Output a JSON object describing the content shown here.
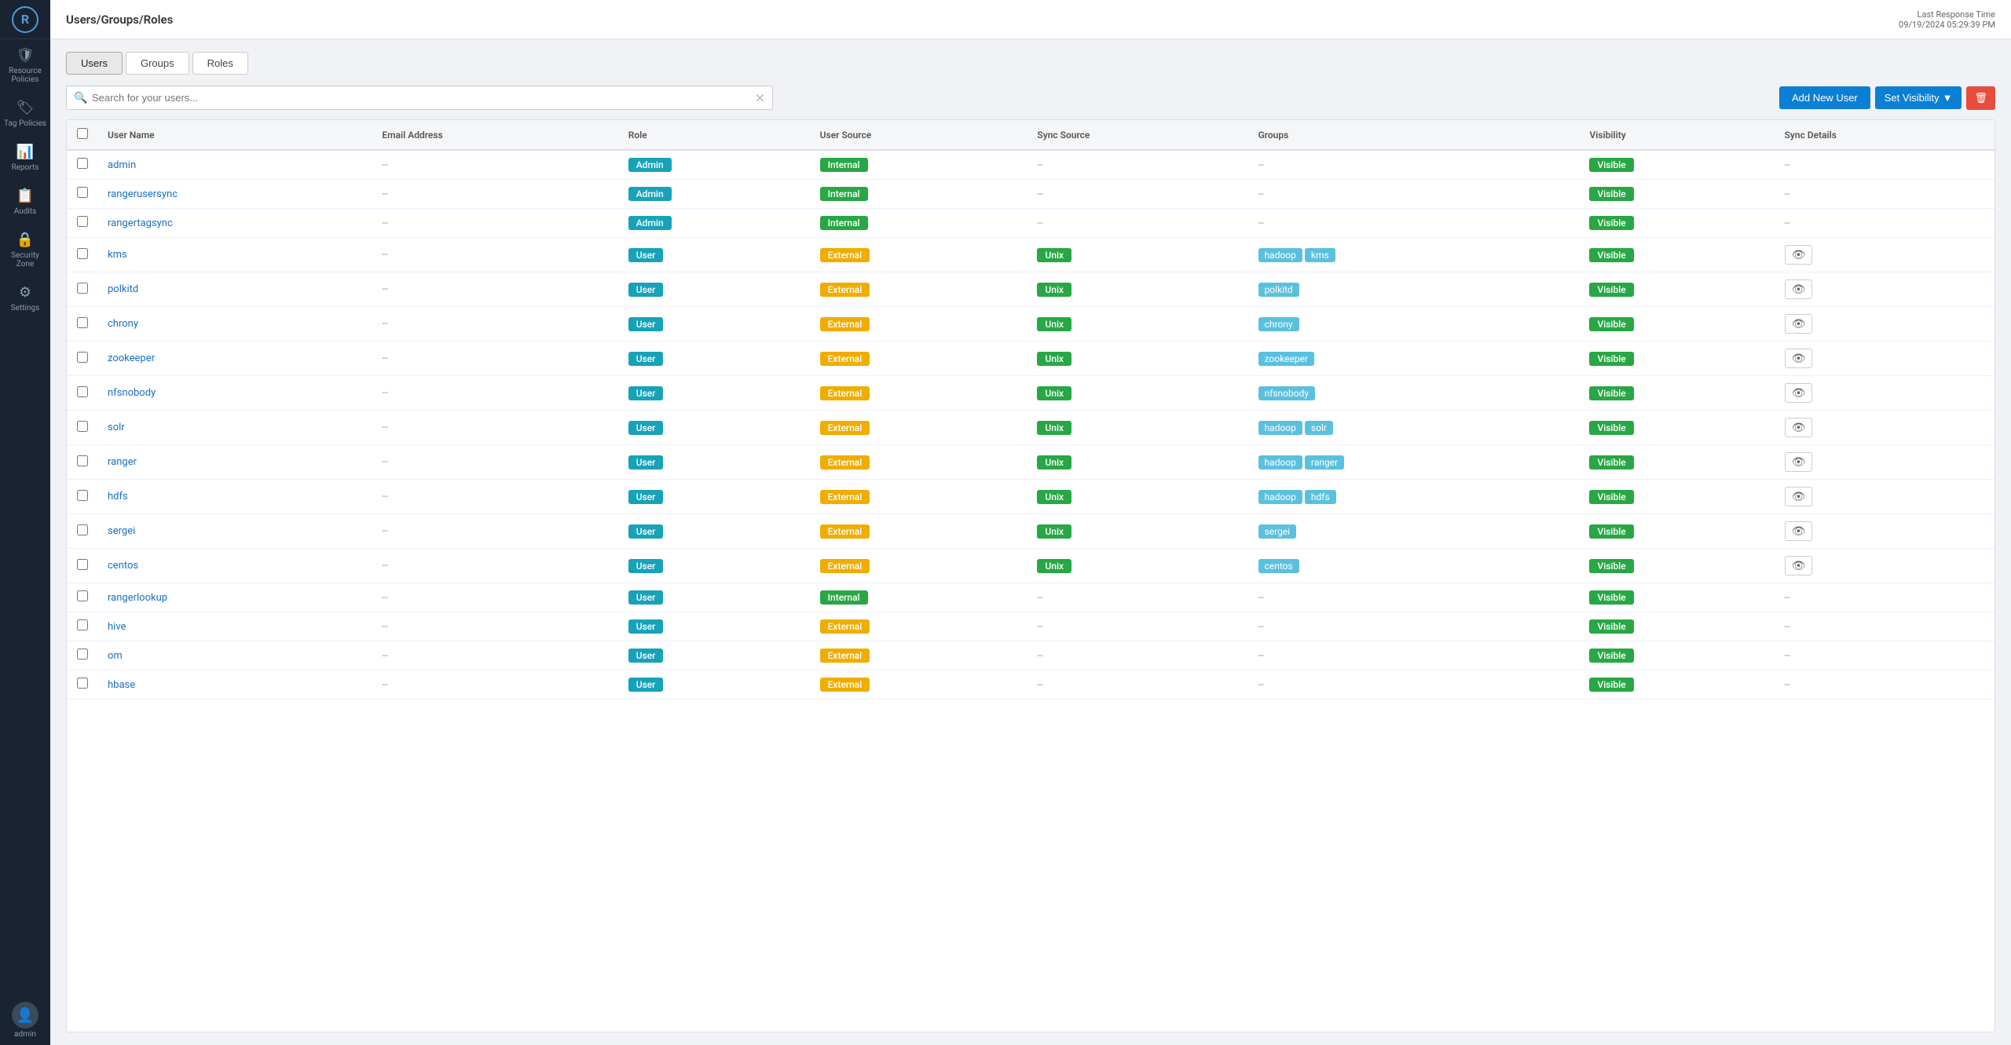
{
  "sidebar": {
    "logo": "R",
    "items": [
      {
        "id": "resource-policies",
        "label": "Resource Policies",
        "icon": "🛡"
      },
      {
        "id": "tag-policies",
        "label": "Tag Policies",
        "icon": "🏷"
      },
      {
        "id": "reports",
        "label": "Reports",
        "icon": "📊"
      },
      {
        "id": "audits",
        "label": "Audits",
        "icon": "📋"
      },
      {
        "id": "security-zone",
        "label": "Security Zone",
        "icon": "🔒"
      },
      {
        "id": "settings",
        "label": "Settings",
        "icon": "⚙"
      }
    ],
    "bottom": {
      "avatar_icon": "👤",
      "user_label": "admin"
    }
  },
  "topbar": {
    "title": "Users/Groups/Roles",
    "meta_label": "Last Response Time",
    "meta_value": "09/19/2024 05:29:39 PM"
  },
  "tabs": [
    {
      "id": "users",
      "label": "Users",
      "active": true
    },
    {
      "id": "groups",
      "label": "Groups",
      "active": false
    },
    {
      "id": "roles",
      "label": "Roles",
      "active": false
    }
  ],
  "toolbar": {
    "search_placeholder": "Search for your users...",
    "add_button": "Add New User",
    "visibility_button": "Set Visibility",
    "delete_icon": "🗑"
  },
  "table": {
    "columns": [
      "",
      "User Name",
      "Email Address",
      "Role",
      "User Source",
      "Sync Source",
      "Groups",
      "Visibility",
      "Sync Details"
    ],
    "rows": [
      {
        "name": "admin",
        "email": "--",
        "role": "Admin",
        "role_type": "admin",
        "user_source": "Internal",
        "user_source_type": "internal",
        "sync_source": "--",
        "groups": [],
        "visibility": "Visible",
        "sync_details": "--",
        "show_eye": false
      },
      {
        "name": "rangerusersync",
        "email": "--",
        "role": "Admin",
        "role_type": "admin",
        "user_source": "Internal",
        "user_source_type": "internal",
        "sync_source": "--",
        "groups": [],
        "visibility": "Visible",
        "sync_details": "--",
        "show_eye": false
      },
      {
        "name": "rangertagsync",
        "email": "--",
        "role": "Admin",
        "role_type": "admin",
        "user_source": "Internal",
        "user_source_type": "internal",
        "sync_source": "--",
        "groups": [],
        "visibility": "Visible",
        "sync_details": "--",
        "show_eye": false
      },
      {
        "name": "kms",
        "email": "--",
        "role": "User",
        "role_type": "user",
        "user_source": "External",
        "user_source_type": "external",
        "sync_source": "Unix",
        "groups": [
          "hadoop",
          "kms"
        ],
        "visibility": "Visible",
        "sync_details": "",
        "show_eye": true
      },
      {
        "name": "polkitd",
        "email": "--",
        "role": "User",
        "role_type": "user",
        "user_source": "External",
        "user_source_type": "external",
        "sync_source": "Unix",
        "groups": [
          "polkitd"
        ],
        "visibility": "Visible",
        "sync_details": "",
        "show_eye": true
      },
      {
        "name": "chrony",
        "email": "--",
        "role": "User",
        "role_type": "user",
        "user_source": "External",
        "user_source_type": "external",
        "sync_source": "Unix",
        "groups": [
          "chrony"
        ],
        "visibility": "Visible",
        "sync_details": "",
        "show_eye": true
      },
      {
        "name": "zookeeper",
        "email": "--",
        "role": "User",
        "role_type": "user",
        "user_source": "External",
        "user_source_type": "external",
        "sync_source": "Unix",
        "groups": [
          "zookeeper"
        ],
        "visibility": "Visible",
        "sync_details": "",
        "show_eye": true
      },
      {
        "name": "nfsnobody",
        "email": "--",
        "role": "User",
        "role_type": "user",
        "user_source": "External",
        "user_source_type": "external",
        "sync_source": "Unix",
        "groups": [
          "nfsnobody"
        ],
        "visibility": "Visible",
        "sync_details": "",
        "show_eye": true
      },
      {
        "name": "solr",
        "email": "--",
        "role": "User",
        "role_type": "user",
        "user_source": "External",
        "user_source_type": "external",
        "sync_source": "Unix",
        "groups": [
          "hadoop",
          "solr"
        ],
        "visibility": "Visible",
        "sync_details": "",
        "show_eye": true
      },
      {
        "name": "ranger",
        "email": "--",
        "role": "User",
        "role_type": "user",
        "user_source": "External",
        "user_source_type": "external",
        "sync_source": "Unix",
        "groups": [
          "hadoop",
          "ranger"
        ],
        "visibility": "Visible",
        "sync_details": "",
        "show_eye": true
      },
      {
        "name": "hdfs",
        "email": "--",
        "role": "User",
        "role_type": "user",
        "user_source": "External",
        "user_source_type": "external",
        "sync_source": "Unix",
        "groups": [
          "hadoop",
          "hdfs"
        ],
        "visibility": "Visible",
        "sync_details": "",
        "show_eye": true
      },
      {
        "name": "sergei",
        "email": "--",
        "role": "User",
        "role_type": "user",
        "user_source": "External",
        "user_source_type": "external",
        "sync_source": "Unix",
        "groups": [
          "sergei"
        ],
        "visibility": "Visible",
        "sync_details": "",
        "show_eye": true
      },
      {
        "name": "centos",
        "email": "--",
        "role": "User",
        "role_type": "user",
        "user_source": "External",
        "user_source_type": "external",
        "sync_source": "Unix",
        "groups": [
          "centos"
        ],
        "visibility": "Visible",
        "sync_details": "",
        "show_eye": true
      },
      {
        "name": "rangerlookup",
        "email": "--",
        "role": "User",
        "role_type": "user",
        "user_source": "Internal",
        "user_source_type": "internal",
        "sync_source": "--",
        "groups": [],
        "visibility": "Visible",
        "sync_details": "--",
        "show_eye": false
      },
      {
        "name": "hive",
        "email": "--",
        "role": "User",
        "role_type": "user",
        "user_source": "External",
        "user_source_type": "external",
        "sync_source": "--",
        "groups": [],
        "visibility": "Visible",
        "sync_details": "--",
        "show_eye": false
      },
      {
        "name": "om",
        "email": "--",
        "role": "User",
        "role_type": "user",
        "user_source": "External",
        "user_source_type": "external",
        "sync_source": "--",
        "groups": [],
        "visibility": "Visible",
        "sync_details": "--",
        "show_eye": false
      },
      {
        "name": "hbase",
        "email": "--",
        "role": "User",
        "role_type": "user",
        "user_source": "External",
        "user_source_type": "external",
        "sync_source": "--",
        "groups": [],
        "visibility": "Visible",
        "sync_details": "--",
        "show_eye": false
      }
    ]
  }
}
